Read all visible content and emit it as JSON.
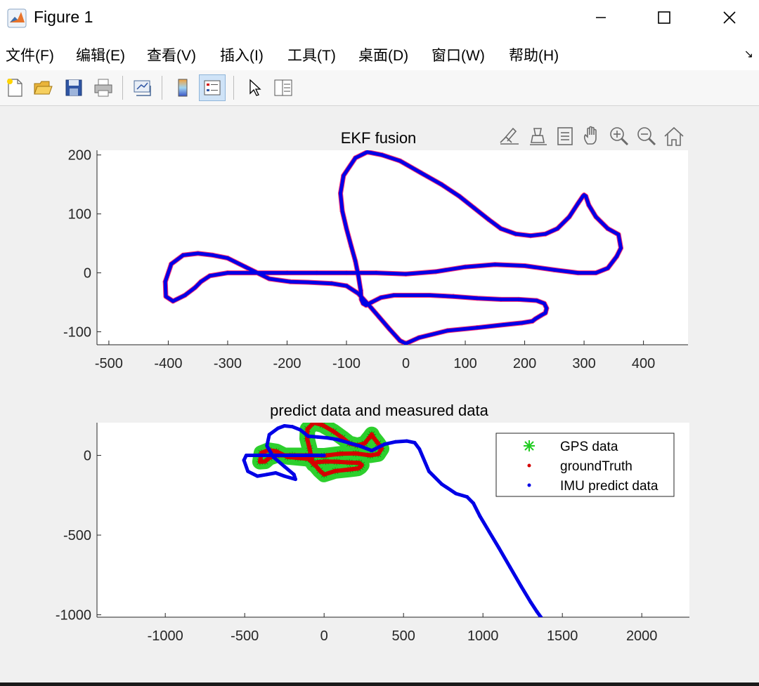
{
  "window": {
    "title": "Figure 1",
    "minimize_glyph": "—",
    "maximize_glyph": "☐",
    "close_glyph": "✕"
  },
  "menu": {
    "items": [
      "文件(F)",
      "编辑(E)",
      "查看(V)",
      "插入(I)",
      "工具(T)",
      "桌面(D)",
      "窗口(W)",
      "帮助(H)"
    ],
    "dock_glyph": "↘"
  },
  "toolbar": {
    "buttons": [
      "new-figure-icon",
      "open-file-icon",
      "save-icon",
      "print-icon",
      "link-plot-icon",
      "colorbar-icon",
      "legend-icon",
      "pointer-icon",
      "property-inspector-icon"
    ],
    "active": "legend-icon"
  },
  "axes_toolbar": {
    "buttons": [
      "brush-icon",
      "data-tips-icon",
      "export-icon",
      "pan-icon",
      "zoom-in-icon",
      "zoom-out-icon",
      "home-icon"
    ]
  },
  "chart_data": [
    {
      "type": "line",
      "title": "EKF fusion",
      "xlabel": "",
      "ylabel": "",
      "xlim": [
        -520,
        475
      ],
      "ylim": [
        -122,
        208
      ],
      "xticks": [
        -500,
        -400,
        -300,
        -200,
        -100,
        0,
        100,
        200,
        300,
        400
      ],
      "yticks": [
        -100,
        0,
        100,
        200
      ],
      "grid": false,
      "series": [
        {
          "color": "#ff2d6e",
          "x": [
            -76,
            -80,
            -85,
            -92,
            -100,
            -107,
            -110,
            -105,
            -85,
            -65,
            -40,
            -10,
            25,
            60,
            90,
            115,
            140,
            160,
            185,
            210,
            235,
            255,
            275,
            290,
            298,
            300,
            303,
            308,
            320,
            340,
            358,
            362,
            355,
            340,
            320,
            290,
            250,
            200,
            150,
            100,
            50,
            0,
            -50,
            -100,
            -150,
            -200,
            -250,
            -300,
            -330,
            -345,
            -355,
            -372,
            -392,
            -404,
            -405,
            -395,
            -375,
            -350,
            -325,
            -300,
            -270,
            -230,
            -195,
            -165,
            -125,
            -100,
            -80,
            -62,
            -45,
            -28,
            -10,
            0,
            22,
            70,
            120,
            165,
            195,
            213,
            218,
            228,
            235,
            237,
            233,
            220,
            190,
            160,
            120,
            80,
            40,
            10,
            -20,
            -42,
            -58,
            -67,
            -72,
            -75,
            -76
          ],
          "y": [
            -30,
            -5,
            20,
            45,
            75,
            105,
            135,
            165,
            195,
            205,
            200,
            190,
            170,
            150,
            130,
            110,
            90,
            75,
            66,
            63,
            66,
            75,
            95,
            118,
            130,
            132,
            130,
            115,
            95,
            75,
            65,
            42,
            28,
            8,
            0,
            0,
            5,
            12,
            14,
            10,
            2,
            -2,
            0,
            0,
            0,
            0,
            0,
            0,
            -5,
            -15,
            -25,
            -38,
            -48,
            -40,
            -15,
            15,
            30,
            33,
            30,
            25,
            10,
            -10,
            -15,
            -16,
            -18,
            -22,
            -35,
            -55,
            -75,
            -95,
            -115,
            -120,
            -110,
            -98,
            -93,
            -88,
            -85,
            -82,
            -78,
            -72,
            -68,
            -60,
            -52,
            -47,
            -45,
            -45,
            -43,
            -40,
            -38,
            -38,
            -38,
            -42,
            -50,
            -55,
            -52,
            -45,
            -30
          ]
        },
        {
          "color": "#0000e6",
          "x": [
            -76,
            -80,
            -85,
            -92,
            -100,
            -107,
            -110,
            -105,
            -85,
            -65,
            -40,
            -10,
            25,
            60,
            90,
            115,
            140,
            160,
            185,
            210,
            235,
            255,
            275,
            290,
            298,
            300,
            303,
            308,
            320,
            340,
            358,
            362,
            355,
            340,
            320,
            290,
            250,
            200,
            150,
            100,
            50,
            0,
            -50,
            -100,
            -150,
            -200,
            -250,
            -300,
            -330,
            -345,
            -355,
            -372,
            -392,
            -404,
            -405,
            -395,
            -375,
            -350,
            -325,
            -300,
            -270,
            -230,
            -195,
            -165,
            -125,
            -100,
            -80,
            -62,
            -45,
            -28,
            -10,
            0,
            22,
            70,
            120,
            165,
            195,
            213,
            218,
            228,
            235,
            237,
            233,
            220,
            190,
            160,
            120,
            80,
            40,
            10,
            -20,
            -42,
            -58,
            -67,
            -72,
            -75,
            -76
          ],
          "y": [
            -30,
            -5,
            20,
            45,
            75,
            105,
            135,
            165,
            195,
            205,
            200,
            190,
            170,
            150,
            130,
            110,
            90,
            75,
            66,
            63,
            66,
            75,
            95,
            118,
            130,
            132,
            130,
            115,
            95,
            75,
            65,
            42,
            28,
            8,
            0,
            0,
            5,
            12,
            14,
            10,
            2,
            -2,
            0,
            0,
            0,
            0,
            0,
            0,
            -5,
            -15,
            -25,
            -38,
            -48,
            -40,
            -15,
            15,
            30,
            33,
            30,
            25,
            10,
            -10,
            -15,
            -16,
            -18,
            -22,
            -35,
            -55,
            -75,
            -95,
            -115,
            -120,
            -110,
            -98,
            -93,
            -88,
            -85,
            -82,
            -78,
            -72,
            -68,
            -60,
            -52,
            -47,
            -45,
            -45,
            -43,
            -40,
            -38,
            -38,
            -38,
            -42,
            -50,
            -55,
            -52,
            -45,
            -30
          ]
        }
      ]
    },
    {
      "type": "scatter",
      "title": "predict data and measured data",
      "xlabel": "",
      "ylabel": "",
      "xlim": [
        -1430,
        2300
      ],
      "ylim": [
        -1015,
        205
      ],
      "xticks": [
        -1000,
        -500,
        0,
        500,
        1000,
        1500,
        2000
      ],
      "yticks": [
        -1000,
        -500,
        0
      ],
      "grid": false,
      "legend_position": "top-right",
      "series": [
        {
          "name": "GPS data",
          "color": "#22cc22",
          "marker": "asterisk",
          "x": [
            -76,
            -92,
            -107,
            -105,
            -65,
            -10,
            60,
            115,
            160,
            210,
            255,
            290,
            300,
            308,
            340,
            362,
            340,
            290,
            200,
            100,
            0,
            -100,
            -200,
            -300,
            -345,
            -372,
            -404,
            -395,
            -350,
            -300,
            -230,
            -165,
            -100,
            -62,
            -28,
            0,
            70,
            165,
            213,
            228,
            237,
            220,
            160,
            80,
            10,
            -42,
            -67,
            -76
          ],
          "y": [
            -30,
            45,
            105,
            165,
            205,
            190,
            150,
            110,
            75,
            63,
            75,
            118,
            132,
            115,
            75,
            42,
            8,
            0,
            12,
            10,
            -2,
            0,
            0,
            0,
            -15,
            -38,
            -40,
            15,
            33,
            25,
            -10,
            -16,
            -22,
            -55,
            -95,
            -120,
            -98,
            -88,
            -82,
            -72,
            -60,
            -47,
            -45,
            -40,
            -38,
            -42,
            -55,
            -30
          ]
        },
        {
          "name": "groundTruth",
          "color": "#d40000",
          "marker": "dot",
          "x": [
            -76,
            -92,
            -107,
            -105,
            -65,
            -10,
            60,
            115,
            160,
            210,
            255,
            290,
            300,
            308,
            340,
            362,
            340,
            290,
            200,
            100,
            0,
            -100,
            -200,
            -300,
            -345,
            -372,
            -404,
            -395,
            -350,
            -300,
            -230,
            -165,
            -100,
            -62,
            -28,
            0,
            70,
            165,
            213,
            228,
            237,
            220,
            160,
            80,
            10,
            -42,
            -67,
            -76
          ],
          "y": [
            -30,
            45,
            105,
            165,
            205,
            190,
            150,
            110,
            75,
            63,
            75,
            118,
            132,
            115,
            75,
            42,
            8,
            0,
            12,
            10,
            -2,
            0,
            0,
            0,
            -15,
            -38,
            -40,
            15,
            33,
            25,
            -10,
            -16,
            -22,
            -55,
            -95,
            -120,
            -98,
            -88,
            -82,
            -72,
            -60,
            -47,
            -45,
            -40,
            -38,
            -42,
            -55,
            -30
          ]
        },
        {
          "name": "IMU predict data",
          "color": "#0000e6",
          "marker": "dot",
          "x": [
            0,
            -150,
            -300,
            -400,
            -490,
            -505,
            -480,
            -420,
            -360,
            -305,
            -250,
            -180,
            -190,
            -250,
            -320,
            -360,
            -345,
            -290,
            -250,
            -200,
            -150,
            -100,
            -40,
            20,
            80,
            150,
            220,
            300,
            380,
            450,
            520,
            570,
            600,
            660,
            740,
            830,
            900,
            940,
            980,
            1040,
            1100,
            1170,
            1240,
            1300,
            1340,
            1365
          ],
          "y": [
            0,
            0,
            0,
            0,
            0,
            -30,
            -100,
            -130,
            -120,
            -110,
            -130,
            -150,
            -120,
            -70,
            -10,
            60,
            130,
            170,
            185,
            180,
            160,
            120,
            115,
            110,
            100,
            80,
            60,
            30,
            70,
            85,
            90,
            80,
            40,
            -100,
            -180,
            -240,
            -260,
            -300,
            -380,
            -480,
            -580,
            -700,
            -820,
            -920,
            -980,
            -1015
          ]
        }
      ]
    }
  ]
}
